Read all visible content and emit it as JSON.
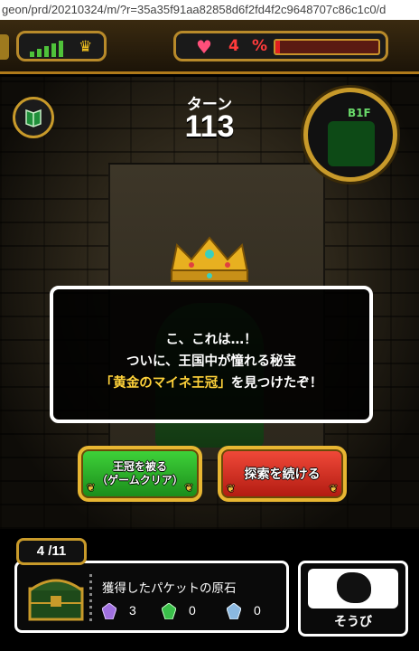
{
  "browser": {
    "url": "geon/prd/20210324/m/?r=35a35f91aa82858d6f2fd4f2c9648707c86c1c0/d"
  },
  "status": {
    "signal_icon": "signal-bars-icon",
    "crown_icon": "crown-icon",
    "heart_icon": "heart-icon",
    "stamina_value": "4",
    "stamina_unit": "%",
    "stamina_fraction": 0.04,
    "stamina_color": "#e02020"
  },
  "hud": {
    "turn_label": "ターン",
    "turn_value": "113",
    "floor_label": "B1F",
    "book_icon": "book-icon",
    "minimap_icon": "minimap-icon"
  },
  "dialog": {
    "line1": "こ、これは…！",
    "line2": "ついに、王国中が憧れる秘宝",
    "item_name": "「黄金のマイネ王冠」",
    "line3_suffix": "を見つけたぞ！"
  },
  "choices": {
    "wear_crown_line1": "王冠を被る",
    "wear_crown_line2": "（ゲームクリア）",
    "continue_label": "探索を続ける"
  },
  "loot": {
    "counter": "4 /11",
    "title": "獲得したパケットの原石",
    "gems": [
      {
        "icon": "purple-gem-icon",
        "count": "3",
        "color": "#a070e0"
      },
      {
        "icon": "green-gem-icon",
        "count": "0",
        "color": "#3ac04a"
      },
      {
        "icon": "blue-gem-icon",
        "count": "0",
        "color": "#8ab8e0"
      }
    ]
  },
  "equip": {
    "label": "そうび",
    "icon": "helmet-icon"
  },
  "colors": {
    "gold": "#c89a2a",
    "green_button": "#3fd43a",
    "red_button": "#f24a3a",
    "highlight": "#ffd23a"
  }
}
